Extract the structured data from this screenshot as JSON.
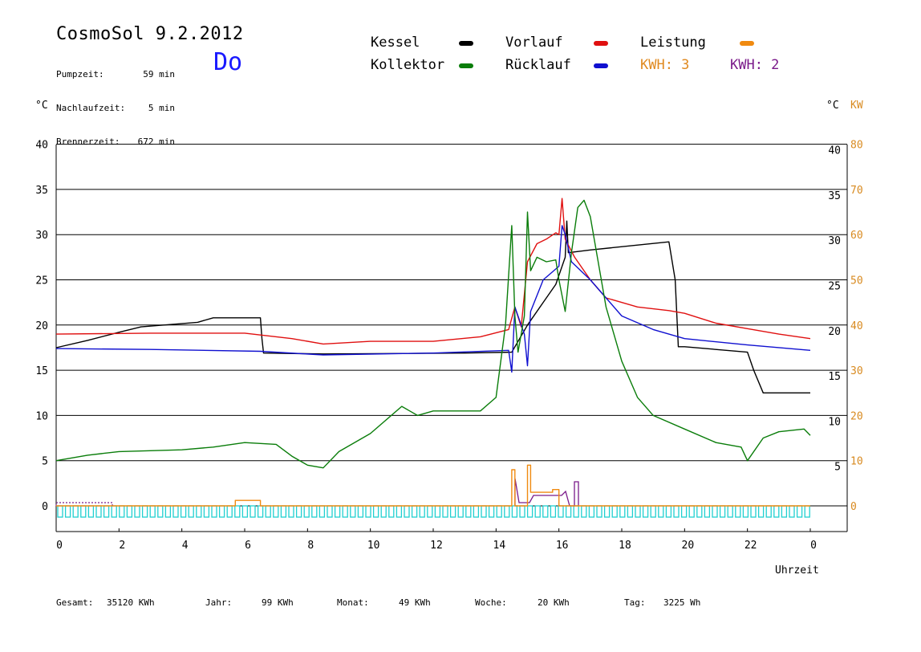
{
  "header": {
    "title": "CosmoSol 9.2.2012",
    "weekday": "Do",
    "stats": [
      {
        "label": "Pumpzeit:",
        "value": "59 min"
      },
      {
        "label": "Nachlaufzeit:",
        "value": "5 min"
      },
      {
        "label": "Brennerzeit:",
        "value": "672 min"
      }
    ]
  },
  "legend": {
    "kessel": {
      "label": "Kessel",
      "color": "#000000"
    },
    "vorlauf": {
      "label": "Vorlauf",
      "color": "#e01010"
    },
    "leistung": {
      "label": "Leistung",
      "color": "#f08a10"
    },
    "kollektor": {
      "label": "Kollektor",
      "color": "#0a7d0a"
    },
    "ruecklauf": {
      "label": "Rücklauf",
      "color": "#1010d0"
    },
    "kwh1": {
      "label": "KWH: 3",
      "color": "#e08a20"
    },
    "kwh2": {
      "label": "KWH: 2",
      "color": "#7a1a8a"
    }
  },
  "units": {
    "left": "°C",
    "right_c": "°C",
    "right_kw": "KW"
  },
  "footer": {
    "gesamt_label": "Gesamt:",
    "gesamt_value": "35120 KWh",
    "jahr_label": "Jahr:",
    "jahr_value": "99 KWh",
    "monat_label": "Monat:",
    "monat_value": "49 KWh",
    "woche_label": "Woche:",
    "woche_value": "20 KWh",
    "tag_label": "Tag:",
    "tag_value": "3225 Wh"
  },
  "chart_data": {
    "type": "line",
    "xlabel": "Uhrzeit",
    "ylabel_left": "°C",
    "ylabel_right": "°C / KW",
    "xlim": [
      0,
      24
    ],
    "ylim": [
      0,
      40
    ],
    "x_ticks": [
      0,
      2,
      4,
      6,
      8,
      10,
      12,
      14,
      16,
      18,
      20,
      22,
      24
    ],
    "x_tick_labels": [
      "0",
      "2",
      "4",
      "6",
      "8",
      "10",
      "12",
      "14",
      "16",
      "18",
      "20",
      "22",
      "0"
    ],
    "y_ticks_left": [
      0,
      5,
      10,
      15,
      20,
      25,
      30,
      35,
      40
    ],
    "y_ticks_right_c": [
      5,
      10,
      15,
      20,
      25,
      30,
      35,
      40
    ],
    "y_ticks_right_kw": [
      0,
      10,
      20,
      30,
      40,
      50,
      60,
      70,
      80
    ],
    "grid": "horizontal",
    "series": [
      {
        "name": "Kessel",
        "color": "#000000",
        "x": [
          0,
          1,
          2,
          2.7,
          4.5,
          5.0,
          6.5,
          6.55,
          6.6,
          8.5,
          13.0,
          14.5,
          15.0,
          15.5,
          15.9,
          16.0,
          16.2,
          16.25,
          16.3,
          17.0,
          19.5,
          19.7,
          19.8,
          20.0,
          22.0,
          22.2,
          22.5,
          24.0
        ],
        "y": [
          17.5,
          18.3,
          19.2,
          19.8,
          20.3,
          20.8,
          20.8,
          18.5,
          16.9,
          16.8,
          16.9,
          17.0,
          20.0,
          22.5,
          24.5,
          25.5,
          27.5,
          31.5,
          28.0,
          28.3,
          29.2,
          25.0,
          17.6,
          17.6,
          17.0,
          15.0,
          12.5,
          12.5
        ]
      },
      {
        "name": "Vorlauf",
        "color": "#e01010",
        "x": [
          0,
          3,
          6,
          6.5,
          7.5,
          8.5,
          10.0,
          12.0,
          13.5,
          14.4,
          14.6,
          14.8,
          15.0,
          15.3,
          15.6,
          15.9,
          16.0,
          16.1,
          16.2,
          16.5,
          17.0,
          17.5,
          18.5,
          19.5,
          20.0,
          21.0,
          22.0,
          23.0,
          24.0
        ],
        "y": [
          19.0,
          19.1,
          19.1,
          18.9,
          18.5,
          17.9,
          18.2,
          18.2,
          18.7,
          19.5,
          22.0,
          19.8,
          27.0,
          29.0,
          29.5,
          30.2,
          30.0,
          34.0,
          29.5,
          27.5,
          25.0,
          23.0,
          22.0,
          21.6,
          21.3,
          20.2,
          19.6,
          19.0,
          18.5
        ]
      },
      {
        "name": "Rücklauf",
        "color": "#1010d0",
        "x": [
          0,
          3,
          6.5,
          8.5,
          12.0,
          14.4,
          14.5,
          14.6,
          14.9,
          15.0,
          15.1,
          15.5,
          16.0,
          16.1,
          16.2,
          16.4,
          17.0,
          17.5,
          18.0,
          19.0,
          20.0,
          22.0,
          24.0
        ],
        "y": [
          17.4,
          17.3,
          17.1,
          16.7,
          16.9,
          17.2,
          14.8,
          22.0,
          19.0,
          15.5,
          21.5,
          25.0,
          26.5,
          31.0,
          30.0,
          27.0,
          25.0,
          23.0,
          21.0,
          19.5,
          18.5,
          17.8,
          17.2
        ]
      },
      {
        "name": "Kollektor",
        "color": "#0a7d0a",
        "x": [
          0,
          1,
          2,
          4,
          5,
          6,
          7,
          7.5,
          8,
          8.5,
          9,
          10,
          11,
          11.5,
          12,
          13,
          13.5,
          14,
          14.3,
          14.5,
          14.6,
          14.7,
          14.9,
          15.0,
          15.1,
          15.3,
          15.6,
          15.9,
          16.0,
          16.2,
          16.4,
          16.6,
          16.8,
          17.0,
          17.5,
          18.0,
          18.5,
          19.0,
          20.0,
          21.0,
          21.8,
          22.0,
          22.5,
          23.0,
          23.8,
          24.0
        ],
        "y": [
          5.0,
          5.6,
          6.0,
          6.2,
          6.5,
          7.0,
          6.8,
          5.5,
          4.5,
          4.2,
          6.0,
          8.0,
          11.0,
          10.0,
          10.5,
          10.5,
          10.5,
          12.0,
          20.0,
          31.0,
          21.0,
          17.0,
          21.0,
          32.5,
          26.0,
          27.5,
          27.0,
          27.2,
          25.0,
          21.5,
          28.0,
          33.0,
          33.8,
          32.0,
          22.0,
          16.0,
          12.0,
          10.0,
          8.5,
          7.0,
          6.5,
          5.0,
          7.5,
          8.2,
          8.5,
          7.8
        ]
      },
      {
        "name": "Leistung",
        "color": "#f08a10",
        "x": [
          0,
          5.7,
          5.7,
          6.5,
          6.5,
          14.5,
          14.5,
          14.6,
          14.6,
          15.0,
          15.0,
          15.1,
          15.1,
          15.8,
          15.8,
          16.0,
          16.0,
          24.0
        ],
        "y": [
          0,
          0,
          0.6,
          0.6,
          0,
          0,
          4.0,
          4.0,
          0,
          0,
          4.5,
          4.5,
          1.5,
          1.5,
          1.8,
          1.8,
          0,
          0
        ]
      }
    ]
  }
}
